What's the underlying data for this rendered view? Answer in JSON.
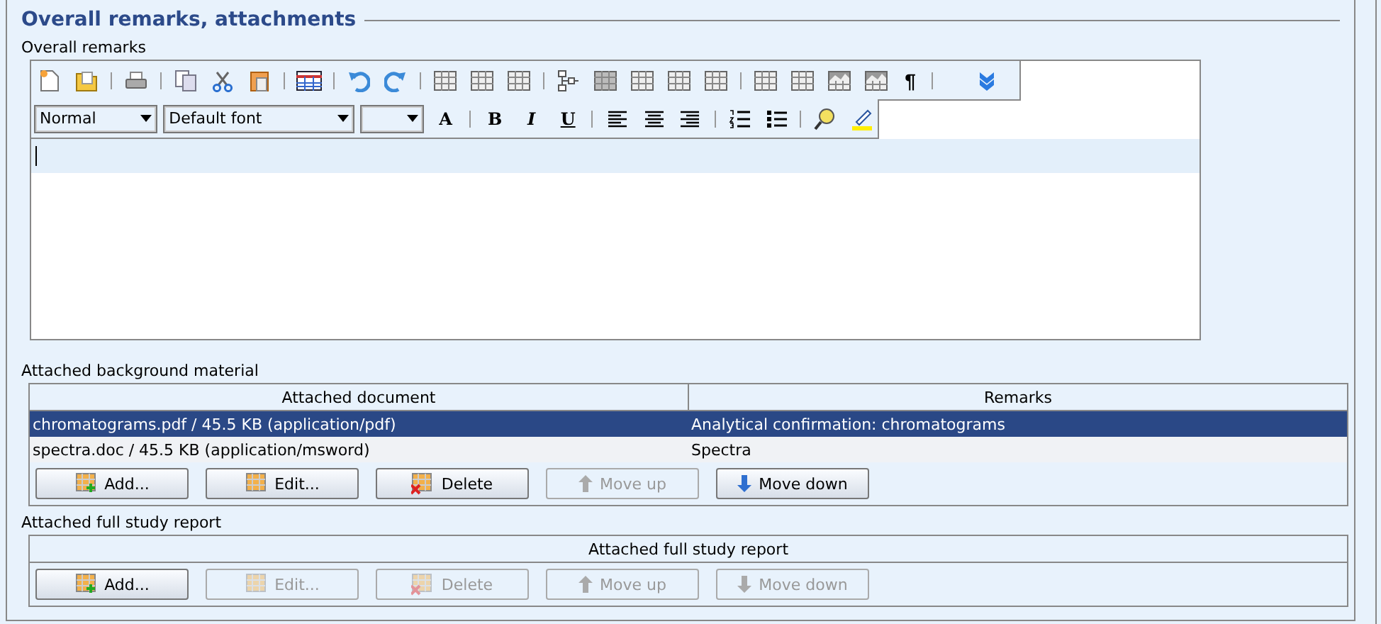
{
  "section": {
    "title": "Overall remarks, attachments"
  },
  "editor": {
    "label": "Overall remarks",
    "pilcrow": "¶",
    "style": "Normal",
    "font": "Default font",
    "grow_font": "A",
    "format": [
      {
        "kind": "bold",
        "text": "B"
      },
      {
        "kind": "italic",
        "text": "I"
      },
      {
        "kind": "underline",
        "text": "U"
      }
    ]
  },
  "background": {
    "label": "Attached background material",
    "columns": [
      "Attached document",
      "Remarks"
    ],
    "rows": [
      {
        "cells": [
          "chromatograms.pdf / 45.5 KB (application/pdf)",
          "Analytical confirmation: chromatograms"
        ],
        "selected": true
      },
      {
        "cells": [
          "spectra.doc / 45.5 KB (application/msword)",
          "Spectra"
        ],
        "selected": false
      }
    ],
    "buttons": [
      {
        "kind": "add",
        "label": "Add...",
        "disabled": false
      },
      {
        "kind": "edit",
        "label": "Edit...",
        "disabled": false
      },
      {
        "kind": "delete",
        "label": "Delete",
        "disabled": false
      },
      {
        "kind": "up",
        "label": "Move up",
        "disabled": true
      },
      {
        "kind": "down",
        "label": "Move down",
        "disabled": false
      }
    ]
  },
  "report": {
    "label": "Attached full study report",
    "columns": [
      "Attached full study report"
    ],
    "buttons": [
      {
        "kind": "add",
        "label": "Add...",
        "disabled": false
      },
      {
        "kind": "edit",
        "label": "Edit...",
        "disabled": true
      },
      {
        "kind": "delete",
        "label": "Delete",
        "disabled": true
      },
      {
        "kind": "up",
        "label": "Move up",
        "disabled": true
      },
      {
        "kind": "down",
        "label": "Move down",
        "disabled": true
      }
    ]
  }
}
